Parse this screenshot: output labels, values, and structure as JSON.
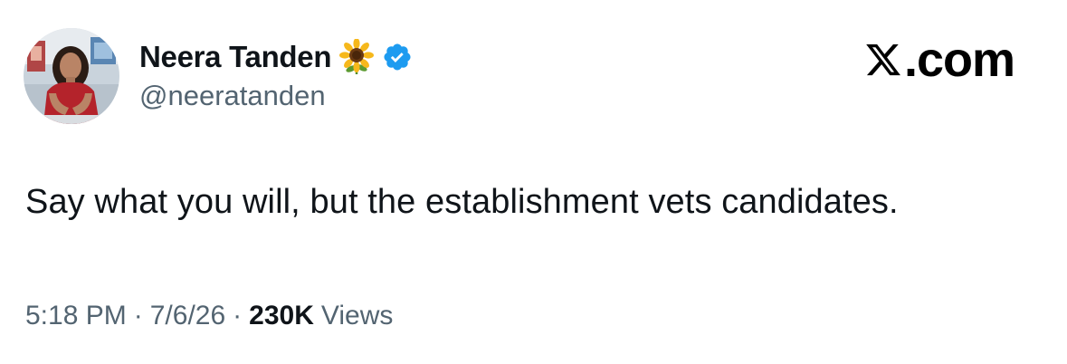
{
  "author": {
    "display_name": "Neera Tanden",
    "emoji_icon": "sunflower-icon",
    "verified_icon": "verified-badge-icon",
    "verified_color": "#1d9bf0",
    "handle": "@neeratanden"
  },
  "brand": {
    "logo_icon": "x-logo-icon",
    "text": ".com"
  },
  "tweet": {
    "text": "Say what you will, but the establishment vets candidates."
  },
  "meta": {
    "time": "5:18 PM",
    "separator": "·",
    "date": "7/6/26",
    "views_count": "230K",
    "views_label": "Views"
  },
  "colors": {
    "text_primary": "#0f1419",
    "text_secondary": "#536471",
    "background": "#ffffff"
  }
}
